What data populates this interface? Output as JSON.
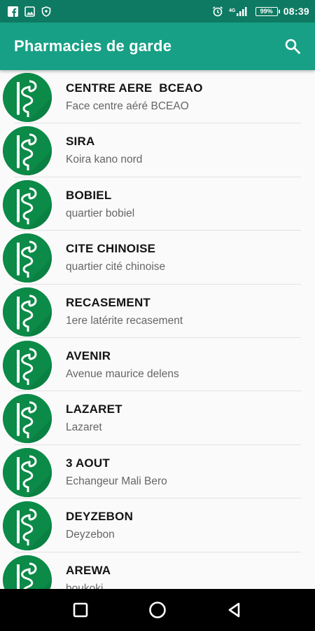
{
  "status_bar": {
    "time": "08:39",
    "battery": "99%",
    "left_icons": [
      "facebook-icon",
      "gallery-icon",
      "shield-icon"
    ],
    "right_icons": [
      "alarm-icon",
      "signal-icon",
      "battery-icon"
    ]
  },
  "app_bar": {
    "title": "Pharmacies de garde",
    "search_icon": "search-icon"
  },
  "colors": {
    "status_bar": "#0e7a63",
    "app_bar": "#17a085",
    "avatar": "#0c8a48"
  },
  "pharmacies": [
    {
      "name": "CENTRE AERE  BCEAO",
      "address": "Face centre aéré BCEAO"
    },
    {
      "name": "SIRA",
      "address": "Koira kano nord"
    },
    {
      "name": "BOBIEL",
      "address": "quartier bobiel"
    },
    {
      "name": "CITE CHINOISE",
      "address": "quartier cité chinoise"
    },
    {
      "name": "RECASEMENT",
      "address": "1ere latérite recasement"
    },
    {
      "name": "AVENIR",
      "address": "Avenue maurice delens"
    },
    {
      "name": "LAZARET",
      "address": "Lazaret"
    },
    {
      "name": "3 AOUT",
      "address": "Echangeur Mali Bero"
    },
    {
      "name": "DEYZEBON",
      "address": "Deyzebon"
    },
    {
      "name": "AREWA",
      "address": "boukoki"
    }
  ],
  "nav_bar": {
    "buttons": [
      "recents-square-icon",
      "home-circle-icon",
      "back-triangle-icon"
    ]
  }
}
